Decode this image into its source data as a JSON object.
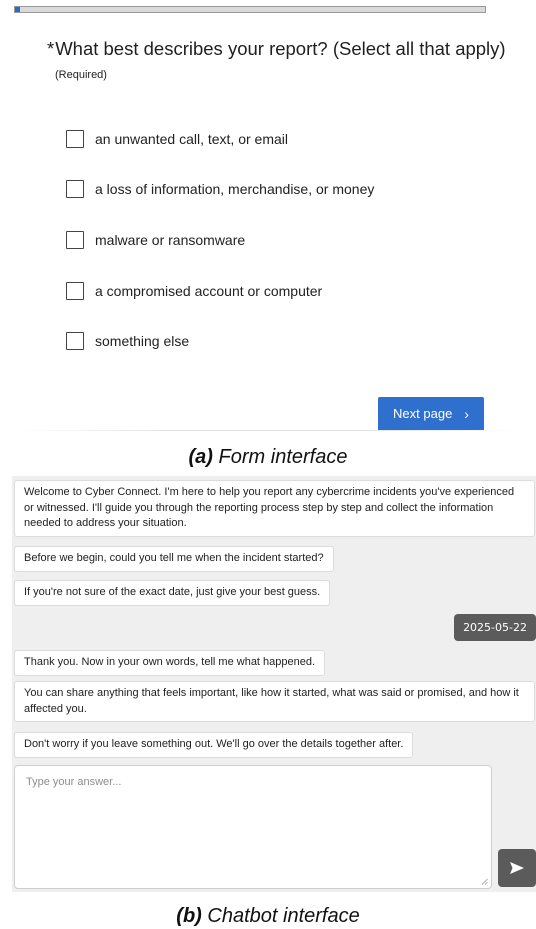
{
  "form": {
    "progress_fraction": 0.01,
    "required_star": "*",
    "question": "What best describes your report? (Select all that apply)",
    "required_note": "(Required)",
    "options": [
      "an unwanted call, text, or email",
      "a loss of information, merchandise, or money",
      "malware or ransomware",
      "a compromised account or computer",
      "something else"
    ],
    "next_label": "Next page",
    "next_icon": "chevron-right-icon"
  },
  "captions": {
    "a": {
      "letter": "(a)",
      "text": "Form interface"
    },
    "b": {
      "letter": "(b)",
      "text": "Chatbot interface"
    }
  },
  "chat": {
    "messages": [
      {
        "from": "bot",
        "text": "Welcome to Cyber Connect. I'm here to help you report any cybercrime incidents you've experienced or witnessed. I'll guide you through the reporting process step by step and collect the information needed to address your situation."
      },
      {
        "from": "bot",
        "text": "Before we begin, could you tell me when the incident started?"
      },
      {
        "from": "bot",
        "text": "If you're not sure of the exact date, just give your best guess."
      },
      {
        "from": "user",
        "text": "2025-05-22"
      },
      {
        "from": "bot",
        "text": "Thank you. Now in your own words, tell me what happened."
      },
      {
        "from": "bot",
        "text": "You can share anything that feels important, like how it started, what was said or promised, and how it affected you."
      },
      {
        "from": "bot",
        "text": "Don't worry if you leave something out. We'll go over the details together after."
      }
    ],
    "input_placeholder": "Type your answer...",
    "send_icon": "send-icon"
  }
}
